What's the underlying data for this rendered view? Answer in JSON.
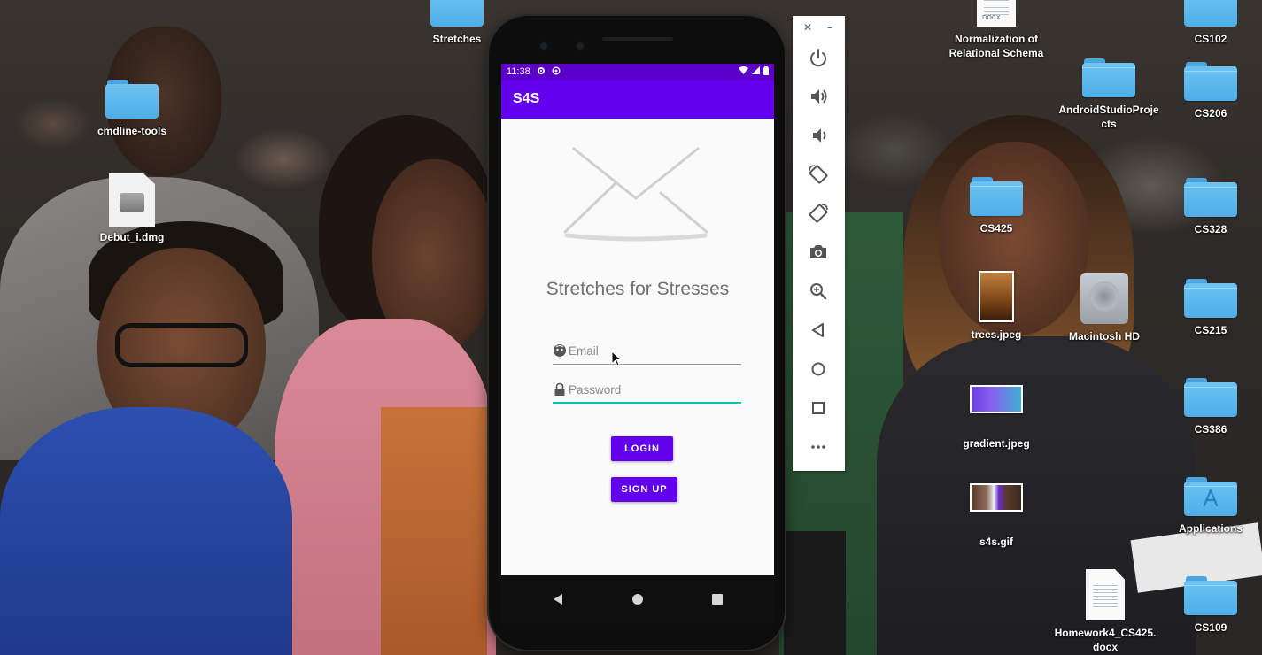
{
  "desktop": {
    "icons": [
      {
        "label": "Stretches"
      },
      {
        "label": "cmdline-tools"
      },
      {
        "label": "Debut_i.dmg"
      },
      {
        "label": "Normalization of Relational Schema",
        "doc_tag": "DOCX"
      },
      {
        "label": "AndroidStudioProjects"
      },
      {
        "label": "CS425"
      },
      {
        "label": "trees.jpeg"
      },
      {
        "label": "gradient.jpeg"
      },
      {
        "label": "s4s.gif"
      },
      {
        "label": "Homework4_CS425.docx"
      },
      {
        "label": "Macintosh HD"
      },
      {
        "label": "CS102"
      },
      {
        "label": "CS206"
      },
      {
        "label": "CS328"
      },
      {
        "label": "CS215"
      },
      {
        "label": "CS386"
      },
      {
        "label": "Applications"
      },
      {
        "label": "CS109"
      }
    ]
  },
  "phone": {
    "status_bar": {
      "time": "11:38",
      "icons": [
        "gear-icon",
        "sync-icon",
        "wifi-icon",
        "signal-icon",
        "battery-icon"
      ]
    },
    "app_bar": {
      "title": "S4S"
    },
    "app": {
      "logo_icon": "envelope-icon",
      "title": "Stretches for Stresses",
      "email": {
        "placeholder": "Email",
        "value": ""
      },
      "password": {
        "placeholder": "Password",
        "value": ""
      },
      "login_label": "LOGIN",
      "signup_label": "SIGN UP"
    },
    "nav_bar": [
      "back-icon",
      "home-icon",
      "recents-icon"
    ]
  },
  "emulator_toolbar": {
    "window_controls": [
      "close-icon",
      "minimize-icon"
    ],
    "buttons": [
      "power-icon",
      "volume-up-icon",
      "volume-down-icon",
      "rotate-left-icon",
      "rotate-right-icon",
      "camera-icon",
      "zoom-icon",
      "back-icon",
      "home-icon",
      "overview-icon",
      "more-icon"
    ]
  },
  "colors": {
    "primary": "#6200ee",
    "primary_dark": "#5b00c9",
    "accent": "#03c4b3",
    "folder_blue": "#5ab8ee"
  }
}
